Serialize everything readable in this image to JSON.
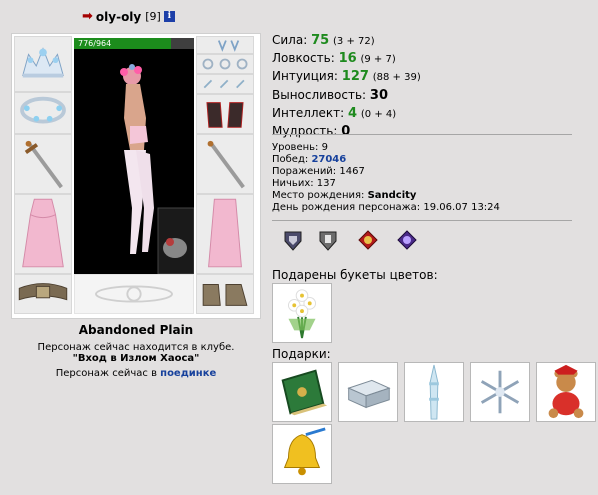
{
  "character": {
    "nickname": "oly-oly",
    "level_bracket": "[9]",
    "info_icon": "i",
    "hp_text": "776/964",
    "hp_fraction": 0.805
  },
  "location": {
    "name": "Abandoned Plain",
    "club_line": "Персонаж сейчас находится в клубе.",
    "club_name": "\"Вход в Излом Хаоса\"",
    "duel_prefix": "Персонаж сейчас в",
    "duel_link": "поединке"
  },
  "stats": [
    {
      "name": "Сила:",
      "value": "75",
      "bonus": "(3 + 72)",
      "color": "green"
    },
    {
      "name": "Ловкость:",
      "value": "16",
      "bonus": "(9 + 7)",
      "color": "green"
    },
    {
      "name": "Интуиция:",
      "value": "127",
      "bonus": "(88 + 39)",
      "color": "green"
    },
    {
      "name": "Выносливость:",
      "value": "30",
      "bonus": "",
      "color": "black"
    },
    {
      "name": "Интеллект:",
      "value": "4",
      "bonus": "(0 + 4)",
      "color": "green"
    },
    {
      "name": "Мудрость:",
      "value": "0",
      "bonus": "",
      "color": "black"
    }
  ],
  "info": {
    "level_label": "Уровень:",
    "level": "9",
    "wins_label": "Побед:",
    "wins": "27046",
    "losses_label": "Поражений:",
    "losses": "1467",
    "draws_label": "Ничьих:",
    "draws": "137",
    "birthplace_label": "Место рождения:",
    "birthplace": "Sandcity",
    "birthday_label": "День рождения персонажа:",
    "birthday": "19.06.07 13:24"
  },
  "badges": [
    "shield-badge-icon",
    "knight-badge-icon",
    "red-crest-badge-icon",
    "purple-crest-badge-icon"
  ],
  "flowers_title": "Подарены букеты цветов:",
  "gifts_title": "Подарки:",
  "gifts": [
    "green-book-icon",
    "silver-box-icon",
    "ice-spire-icon",
    "snowflake-icon",
    "teddy-bear-icon",
    "golden-bell-icon"
  ],
  "colors": {
    "accent_green": "#1e8a1e",
    "link_blue": "#17419c",
    "hp_green": "#1c8c1c",
    "background": "#e2e0e0"
  }
}
